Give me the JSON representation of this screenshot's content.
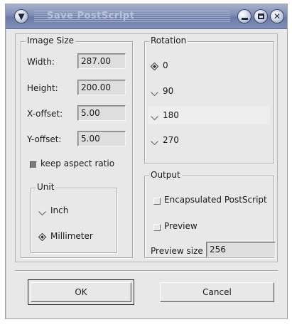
{
  "window": {
    "title": "Save PostScript"
  },
  "image_size": {
    "legend": "Image Size",
    "width_label": "Width:",
    "width_value": "287.00",
    "height_label": "Height:",
    "height_value": "200.00",
    "xoffset_label": "X-offset:",
    "xoffset_value": "5.00",
    "yoffset_label": "Y-offset:",
    "yoffset_value": "5.00",
    "keep_aspect_label": "keep aspect ratio",
    "keep_aspect_checked": true
  },
  "unit": {
    "legend": "Unit",
    "options": [
      {
        "label": "Inch",
        "selected": false
      },
      {
        "label": "Millimeter",
        "selected": true
      }
    ]
  },
  "rotation": {
    "legend": "Rotation",
    "options": [
      {
        "label": "0",
        "selected": true
      },
      {
        "label": "90",
        "selected": false
      },
      {
        "label": "180",
        "selected": false
      },
      {
        "label": "270",
        "selected": false
      }
    ]
  },
  "output": {
    "legend": "Output",
    "eps_label": "Encapsulated PostScript",
    "eps_checked": false,
    "preview_label": "Preview",
    "preview_checked": false,
    "preview_size_label": "Preview size",
    "preview_size_value": "256"
  },
  "buttons": {
    "ok": "OK",
    "cancel": "Cancel"
  }
}
